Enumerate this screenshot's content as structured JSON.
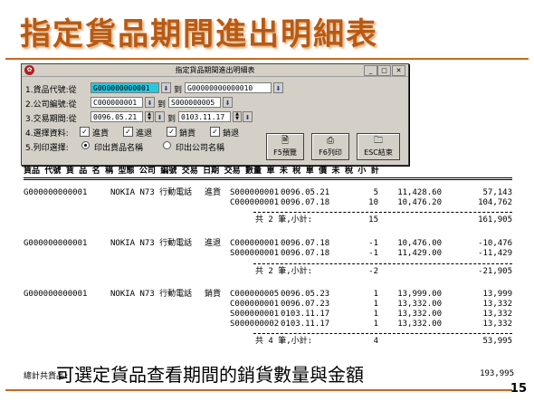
{
  "slide": {
    "title": "指定貨品期間進出明細表",
    "caption": "可選定貨品查看期間的銷貨數量與金額",
    "page_number": "15"
  },
  "dialog": {
    "window_title": "指定貨品期間進出明細表",
    "product_label": "1.貨品代號:從",
    "product_from": "G000000000001",
    "product_to": "G00000000000010",
    "company_label": "2.公司編號:從",
    "company_from": "C000000001",
    "company_to": "S000000005",
    "date_label": "3.交易期間:從",
    "date_from": "0096.05.21",
    "date_to": "0103.11.17",
    "to_text": "到",
    "select_label": "4.選擇資料:",
    "checkboxes": [
      "進貨",
      "進退",
      "銷貨",
      "銷退"
    ],
    "print_label": "5.列印選擇:",
    "radio_options": [
      "印出貨品名稱",
      "印出公司名稱"
    ],
    "buttons": {
      "preview": "F5預覽",
      "print": "F6列印",
      "exit": "ESC結束"
    }
  },
  "report": {
    "header": "貨品 代號 貨 品 名 稱 型態 公司 編號 交易 日期 交易 數量 單 未 稅 單 價 未 稅 小 計",
    "groups": [
      {
        "code": "G000000000001",
        "name": "NOKIA N73 行動電話",
        "type": "進貨",
        "rows": [
          {
            "company": "S000000001",
            "date": "0096.05.21",
            "qty": "5",
            "price": "11,428.60",
            "subtotal": "57,143"
          },
          {
            "company": "C000000001",
            "date": "0096.07.18",
            "qty": "10",
            "price": "10,476.20",
            "subtotal": "104,762"
          }
        ],
        "summary": "共 2 筆,小計:",
        "sum_qty": "15",
        "sum_amount": "161,905"
      },
      {
        "code": "G000000000001",
        "name": "NOKIA N73 行動電話",
        "type": "進退",
        "rows": [
          {
            "company": "C000000001",
            "date": "0096.07.18",
            "qty": "-1",
            "price": "10,476.00",
            "subtotal": "-10,476"
          },
          {
            "company": "S000000001",
            "date": "0096.07.18",
            "qty": "-1",
            "price": "11,429.00",
            "subtotal": "-11,429"
          }
        ],
        "summary": "共 2 筆,小計:",
        "sum_qty": "-2",
        "sum_amount": "-21,905"
      },
      {
        "code": "G000000000001",
        "name": "NOKIA N73 行動電話",
        "type": "銷貨",
        "rows": [
          {
            "company": "C000000005",
            "date": "0096.05.23",
            "qty": "1",
            "price": "13,999.00",
            "subtotal": "13,999"
          },
          {
            "company": "C000000001",
            "date": "0096.07.23",
            "qty": "1",
            "price": "13,332.00",
            "subtotal": "13,332"
          },
          {
            "company": "S000000001",
            "date": "0103.11.17",
            "qty": "1",
            "price": "13,332.00",
            "subtotal": "13,332"
          },
          {
            "company": "S000000002",
            "date": "0103.11.17",
            "qty": "1",
            "price": "13,332.00",
            "subtotal": "13,332"
          }
        ],
        "summary": "共 4 筆,小計:",
        "sum_qty": "4",
        "sum_amount": "53,995"
      }
    ],
    "grand_label": "總計共貨品:",
    "grand_total": "193,995"
  }
}
